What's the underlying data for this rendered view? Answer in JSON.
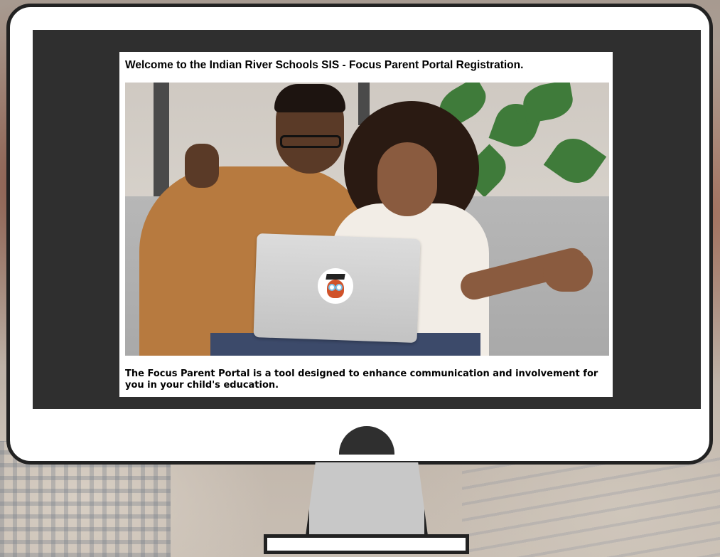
{
  "portal": {
    "title": "Welcome to the Indian River Schools SIS - Focus Parent Portal Registration.",
    "tagline": "The Focus Parent Portal is a tool designed to enhance communication and involvement for you in your child's education."
  },
  "hero": {
    "image_subject": "father and daughter celebrating in front of a laptop",
    "laptop_logo_icon": "focus-owl-icon"
  },
  "colors": {
    "screen_bezel": "#2f2f2f",
    "monitor_frame": "#222222",
    "monitor_body": "#ffffff",
    "page_background": "#ffffff"
  }
}
